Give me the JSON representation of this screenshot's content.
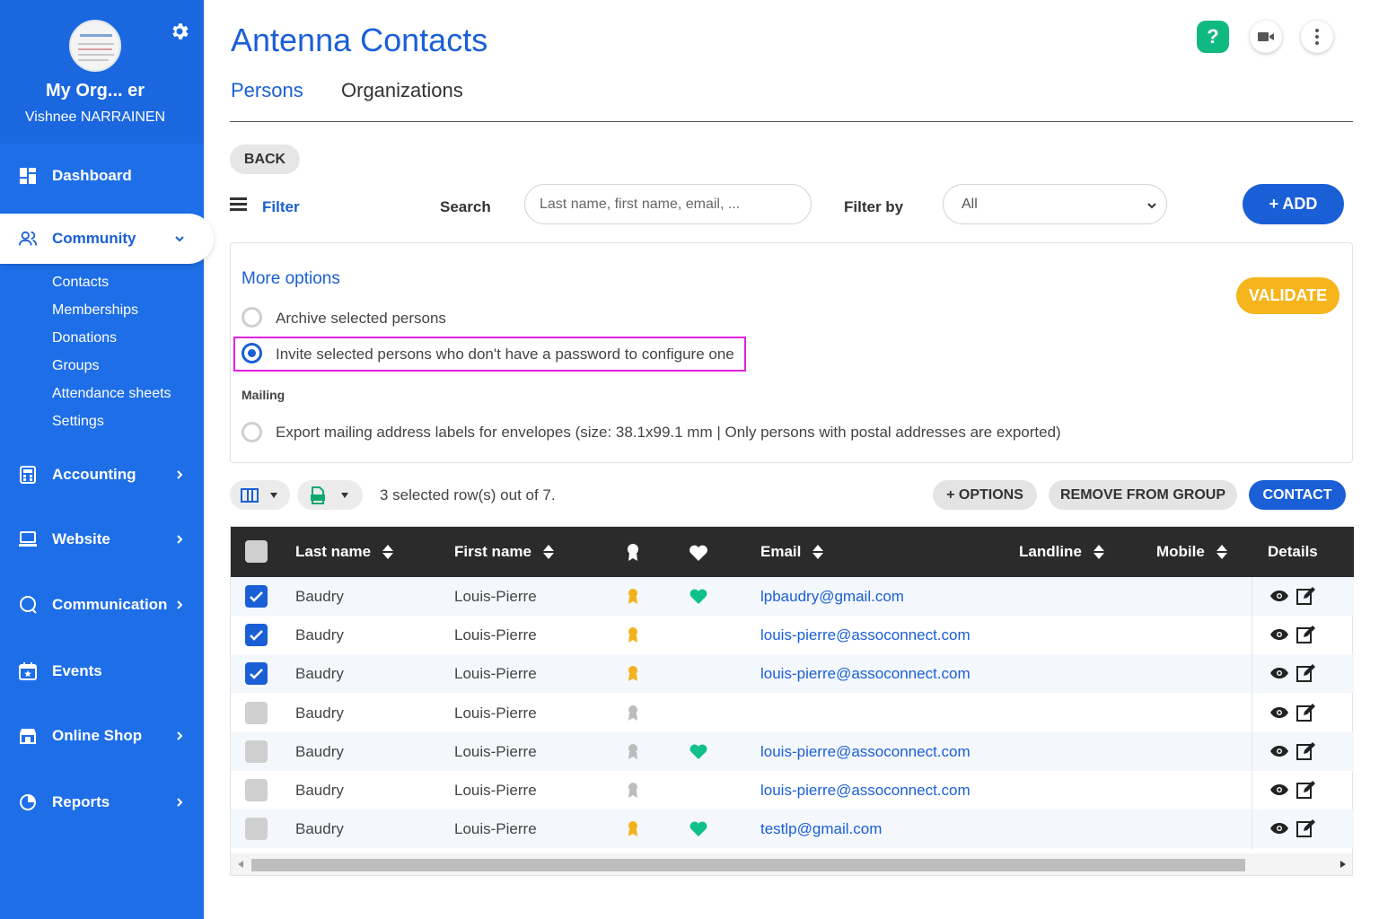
{
  "sidebar": {
    "org_name": "My Org... er",
    "user_name": "Vishnee NARRAINEN",
    "nav": {
      "dashboard": "Dashboard",
      "community": "Community",
      "accounting": "Accounting",
      "website": "Website",
      "communication": "Communication",
      "events": "Events",
      "online_shop": "Online Shop",
      "reports": "Reports"
    },
    "community_sub": [
      "Contacts",
      "Memberships",
      "Donations",
      "Groups",
      "Attendance sheets",
      "Settings"
    ]
  },
  "header": {
    "title": "Antenna Contacts",
    "tabs": [
      "Persons",
      "Organizations"
    ],
    "help_label": "?"
  },
  "toolbar": {
    "back_label": "BACK",
    "filter_label": "Filter",
    "search_label": "Search",
    "search_placeholder": "Last name, first name, email, ...",
    "filter_by_label": "Filter by",
    "filter_by_value": "All",
    "add_label": "+ ADD"
  },
  "options": {
    "title": "More options",
    "validate_label": "VALIDATE",
    "archive_label": "Archive selected persons",
    "invite_label": "Invite selected persons who don't have a password to configure one",
    "mailing_heading": "Mailing",
    "export_label": "Export mailing address labels for envelopes (size: 38.1x99.1 mm | Only persons with postal addresses are exported)",
    "selected_option": "invite"
  },
  "actions": {
    "selection_text": "3 selected row(s) out of 7.",
    "options_label": "+ OPTIONS",
    "remove_label": "REMOVE FROM GROUP",
    "contact_label": "CONTACT"
  },
  "table": {
    "columns": [
      "Last name",
      "First name",
      "",
      "",
      "Email",
      "Landline",
      "Mobile",
      "Details"
    ],
    "rows": [
      {
        "checked": true,
        "last": "Baudry",
        "first": "Louis-Pierre",
        "badge": "gold",
        "heart": true,
        "email": "lpbaudry@gmail.com"
      },
      {
        "checked": true,
        "last": "Baudry",
        "first": "Louis-Pierre",
        "badge": "gold",
        "heart": false,
        "email": "louis-pierre@assoconnect.com"
      },
      {
        "checked": true,
        "last": "Baudry",
        "first": "Louis-Pierre",
        "badge": "gold",
        "heart": false,
        "email": "louis-pierre@assoconnect.com"
      },
      {
        "checked": false,
        "last": "Baudry",
        "first": "Louis-Pierre",
        "badge": "gray",
        "heart": false,
        "email": ""
      },
      {
        "checked": false,
        "last": "Baudry",
        "first": "Louis-Pierre",
        "badge": "gray",
        "heart": true,
        "email": "louis-pierre@assoconnect.com"
      },
      {
        "checked": false,
        "last": "Baudry",
        "first": "Louis-Pierre",
        "badge": "gray",
        "heart": false,
        "email": "louis-pierre@assoconnect.com"
      },
      {
        "checked": false,
        "last": "Baudry",
        "first": "Louis-Pierre",
        "badge": "gold",
        "heart": true,
        "email": "testlp@gmail.com"
      }
    ]
  },
  "colors": {
    "primary": "#1a5fd6",
    "sidebar": "#1e6ee8",
    "validate": "#f6b51c",
    "heart": "#10c08a",
    "badge_gold": "#f3b21b",
    "badge_gray": "#bdbdbd",
    "highlight": "#e020e0"
  }
}
